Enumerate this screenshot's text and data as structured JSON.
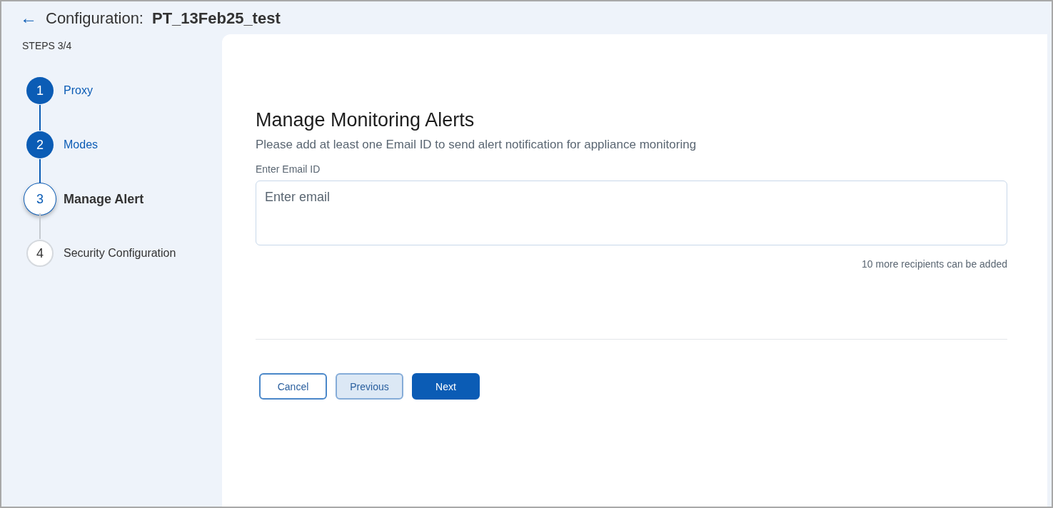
{
  "header": {
    "back": "←",
    "label": "Configuration:",
    "name": "PT_13Feb25_test"
  },
  "stepper": {
    "counter": "STEPS 3/4",
    "steps": [
      {
        "number": "1",
        "label": "Proxy",
        "completed": true,
        "selected": false
      },
      {
        "number": "2",
        "label": "Modes",
        "completed": true,
        "selected": false
      },
      {
        "number": "3",
        "label": "Manage Alert",
        "completed": false,
        "selected": true
      },
      {
        "number": "4",
        "label": "Security Configuration",
        "completed": false,
        "selected": false
      }
    ]
  },
  "form": {
    "title": "Manage Monitoring Alerts",
    "subtitle": "Please add at least one Email ID to send alert notification for appliance monitoring",
    "field_label": "Enter Email ID",
    "placeholder": "Enter email",
    "hint": "10 more recipients can be added"
  },
  "buttons": [
    {
      "label": "Cancel",
      "kind": "outline"
    },
    {
      "label": "Previous",
      "kind": "soft"
    },
    {
      "label": "Next",
      "kind": "primary"
    }
  ]
}
